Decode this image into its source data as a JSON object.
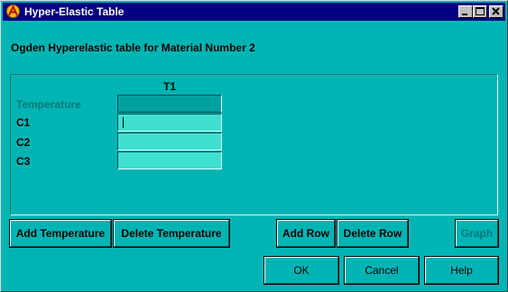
{
  "window": {
    "title": "Hyper-Elastic Table",
    "controls": [
      "minimize",
      "maximize",
      "close"
    ]
  },
  "heading": "Ogden Hyperelastic table for Material Number 2",
  "table": {
    "column_headers": [
      "T1"
    ],
    "rows": [
      {
        "label": "Temperature",
        "value": "",
        "enabled": false
      },
      {
        "label": "C1",
        "value": "",
        "focused": true
      },
      {
        "label": "C2",
        "value": ""
      },
      {
        "label": "C3",
        "value": ""
      }
    ]
  },
  "buttons": {
    "add_temperature": "Add Temperature",
    "delete_temperature": "Delete Temperature",
    "add_row": "Add Row",
    "delete_row": "Delete Row",
    "graph": "Graph",
    "ok": "OK",
    "cancel": "Cancel",
    "help": "Help"
  },
  "colors": {
    "background": "#00b4b4",
    "titlebar": "#000080",
    "cell": "#40e0d0"
  }
}
